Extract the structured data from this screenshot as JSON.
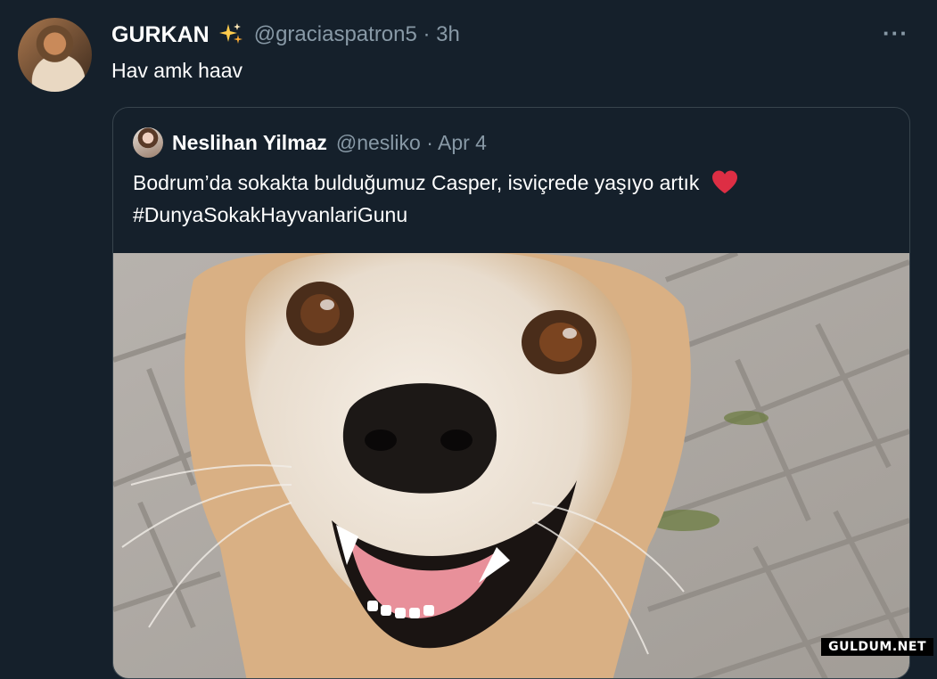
{
  "tweet": {
    "author_name": "GURKAN",
    "author_emoji_icon": "sparkles-icon",
    "handle_time": "@graciaspatron5 · 3h",
    "text": "Hav amk haav",
    "more_label": "···"
  },
  "quoted_tweet": {
    "author_name": "Neslihan Yilmaz",
    "handle_time": "@nesliko · Apr 4",
    "text_line1": "Bodrum’da sokakta bulduğumuz Casper, isviçrede yaşıyo artık",
    "text_emoji_icon": "heart-icon",
    "text_line2": "#DunyaSokakHayvanlariGunu",
    "media_description_icon": "dog-photo"
  },
  "watermark": "GULDUM.NET",
  "colors": {
    "background": "#15202b",
    "secondary_text": "#8899a6",
    "border": "#38444d",
    "heart": "#e0245e"
  }
}
